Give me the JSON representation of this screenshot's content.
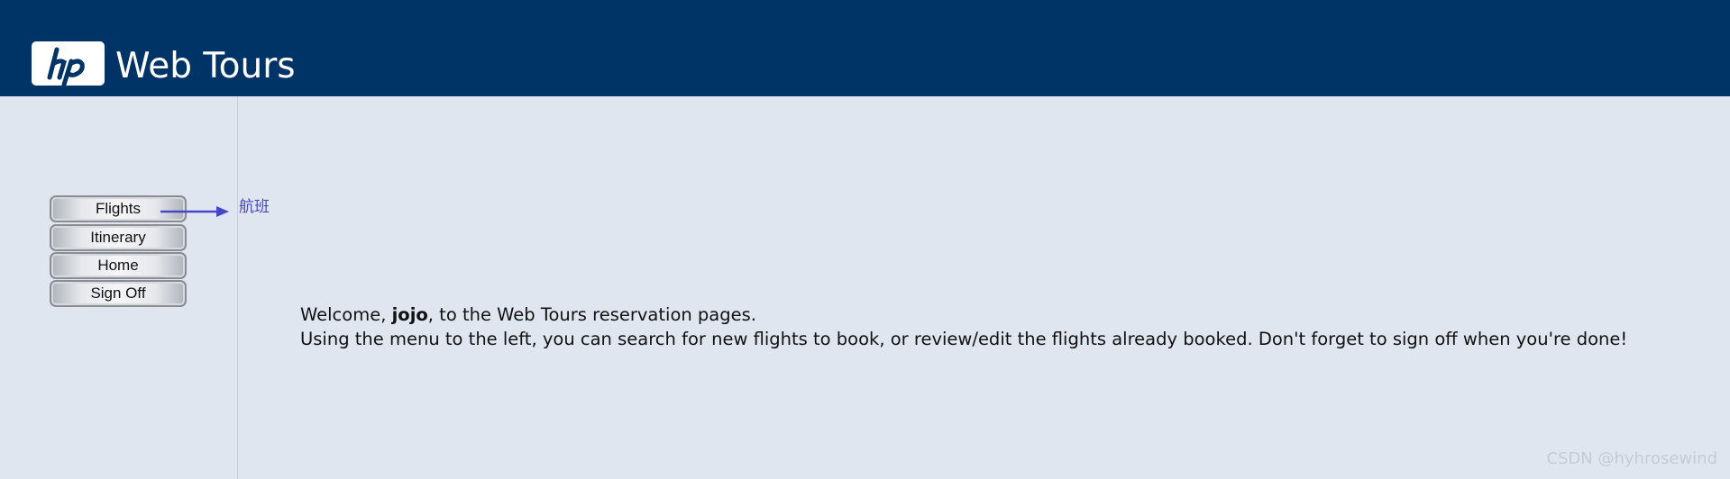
{
  "header": {
    "logo_text": "hp",
    "app_title": "Web Tours",
    "background_color": "#003366"
  },
  "nav": {
    "items": [
      {
        "label": "Flights"
      },
      {
        "label": "Itinerary"
      },
      {
        "label": "Home"
      },
      {
        "label": "Sign Off"
      }
    ]
  },
  "annotation": {
    "label": "航班",
    "color": "#4646c8",
    "icon": "arrow-right-icon"
  },
  "main": {
    "welcome_prefix": "Welcome, ",
    "username": "jojo",
    "welcome_suffix": ", to the Web Tours reservation pages.",
    "instructions": "Using the menu to the left, you can search for new flights to book, or review/edit the flights already booked. Don't forget to sign off when you're done!"
  },
  "watermark": "CSDN @hyhrosewind",
  "colors": {
    "page_background": "#e0e6f0",
    "header": "#003366"
  }
}
